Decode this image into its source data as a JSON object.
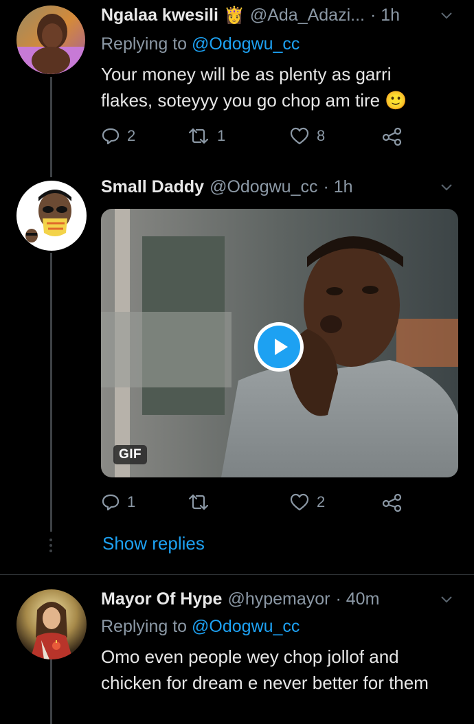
{
  "tweets": [
    {
      "name": "Ngalaa kwesili",
      "badge_emoji": "👸",
      "handle": "@Ada_Adazi...",
      "time": "· 1h",
      "replying_label": "Replying to",
      "replying_to": "@Odogwu_cc",
      "text": "Your money will be as plenty as garri flakes, soteyyy you go chop am tire 🙂",
      "replies": "2",
      "retweets": "1",
      "likes": "8"
    },
    {
      "name": "Small Daddy",
      "handle": "@Odogwu_cc",
      "time": "· 1h",
      "media_badge": "GIF",
      "replies": "1",
      "retweets": "",
      "likes": "2",
      "show_replies": "Show replies"
    },
    {
      "name": "Mayor Of Hype",
      "handle": "@hypemayor",
      "time": "· 40m",
      "replying_label": "Replying to",
      "replying_to": "@Odogwu_cc",
      "text": "Omo even people wey chop jollof and chicken for dream e never better for them"
    }
  ],
  "colors": {
    "background": "#000000",
    "accent": "#1da1f2",
    "secondary_text": "#8b98a5",
    "primary_text": "#e6e6e6"
  },
  "icons": [
    "reply-icon",
    "retweet-icon",
    "like-icon",
    "share-icon",
    "chevron-down-icon",
    "play-icon"
  ]
}
